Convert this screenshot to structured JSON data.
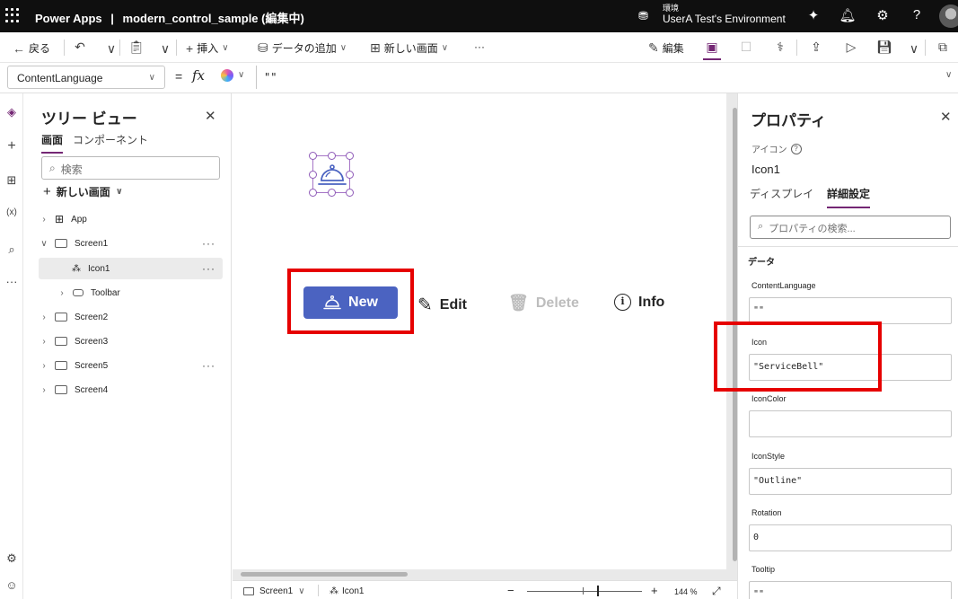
{
  "app": {
    "name": "Power Apps",
    "separator": "|",
    "file": "modern_control_sample (編集中)",
    "env_label": "環境",
    "env_name": "UserA Test's Environment"
  },
  "cmdbar": {
    "back": "戻る",
    "insert": "挿入",
    "add_data": "データの追加",
    "new_screen": "新しい画面",
    "more": "···",
    "edit": "編集"
  },
  "formula": {
    "property": "ContentLanguage",
    "eq": "=",
    "fx": "fx",
    "value": "\"\""
  },
  "tree": {
    "title": "ツリー ビュー",
    "tab_screens": "画面",
    "tab_components": "コンポーネント",
    "search_placeholder": "検索",
    "new_screen": "新しい画面",
    "items": [
      {
        "label": "App"
      },
      {
        "label": "Screen1",
        "more": "···"
      },
      {
        "label": "Icon1",
        "more": "···"
      },
      {
        "label": "Toolbar"
      },
      {
        "label": "Screen2"
      },
      {
        "label": "Screen3"
      },
      {
        "label": "Screen5",
        "more": "···"
      },
      {
        "label": "Screen4"
      }
    ]
  },
  "canvas": {
    "buttons": {
      "new": "New",
      "edit": "Edit",
      "delete": "Delete",
      "info": "Info"
    },
    "highlight_color": "#e60000",
    "primary_color": "#4b63c1"
  },
  "status": {
    "screen": "Screen1",
    "control": "Icon1",
    "minus": "−",
    "plus": "+",
    "zoom": "144 %"
  },
  "props": {
    "title": "プロパティ",
    "type": "アイコン",
    "help": "?",
    "name": "Icon1",
    "tab_display": "ディスプレイ",
    "tab_advanced": "詳細設定",
    "search_placeholder": "プロパティの検索...",
    "section": "データ",
    "fields": [
      {
        "label": "ContentLanguage",
        "value": "\"\""
      },
      {
        "label": "Icon",
        "value": "\"ServiceBell\""
      },
      {
        "label": "IconColor",
        "value": ""
      },
      {
        "label": "IconStyle",
        "value": "\"Outline\""
      },
      {
        "label": "Rotation",
        "value": "0"
      },
      {
        "label": "Tooltip",
        "value": "\"\""
      }
    ]
  },
  "colors": {
    "accent": "#742774",
    "topbar": "#0f0f0f"
  }
}
